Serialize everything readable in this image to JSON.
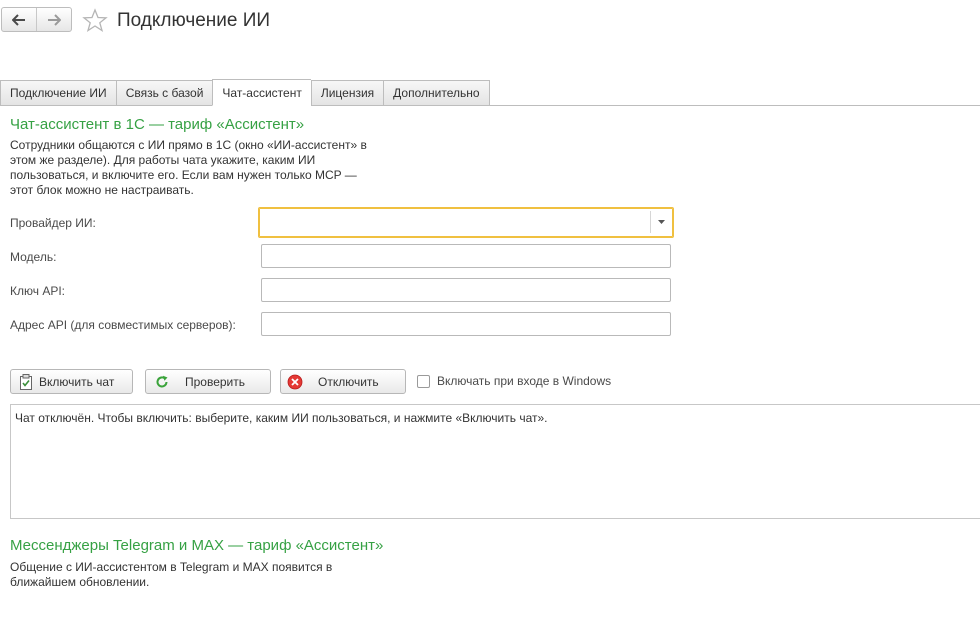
{
  "header": {
    "title": "Подключение ИИ",
    "back_icon": "arrow-left-icon",
    "forward_icon": "arrow-right-icon",
    "favorite_icon": "star-icon"
  },
  "tabs": [
    {
      "label": "Подключение ИИ",
      "active": false
    },
    {
      "label": "Связь с базой",
      "active": false
    },
    {
      "label": "Чат-ассистент",
      "active": true
    },
    {
      "label": "Лицензия",
      "active": false
    },
    {
      "label": "Дополнительно",
      "active": false
    }
  ],
  "chat": {
    "title": "Чат-ассистент в 1С — тариф «Ассистент»",
    "description_lines": [
      "Сотрудники общаются с ИИ прямо в 1С (окно «ИИ-ассистент» в",
      "этом же разделе). Для работы чата укажите, каким ИИ",
      "пользоваться, и включите его. Если вам нужен только MCP —",
      "этот блок можно не настраивать."
    ],
    "fields": {
      "provider_label": "Провайдер ИИ:",
      "provider_value": "",
      "model_label": "Модель:",
      "model_value": "",
      "api_key_label": "Ключ API:",
      "api_key_value": "",
      "api_address_label": "Адрес API (для совместимых серверов):",
      "api_address_value": ""
    },
    "buttons": {
      "enable": "Включить чат",
      "check": "Проверить",
      "disable": "Отключить"
    },
    "autostart_label": "Включать при входе в Windows",
    "autostart_checked": false,
    "status_text": "Чат отключён. Чтобы включить: выберите, каким ИИ пользоваться, и нажмите «Включить чат»."
  },
  "messengers": {
    "title": "Мессенджеры Telegram и MAX — тариф «Ассистент»",
    "description_lines": [
      "Общение с ИИ-ассистентом в Telegram и MAX появится в",
      "ближайшем обновлении."
    ]
  },
  "colors": {
    "accent_green": "#36a144",
    "focus_yellow": "#f0c040",
    "disable_red": "#e53935",
    "check_green": "#3aa33a"
  }
}
